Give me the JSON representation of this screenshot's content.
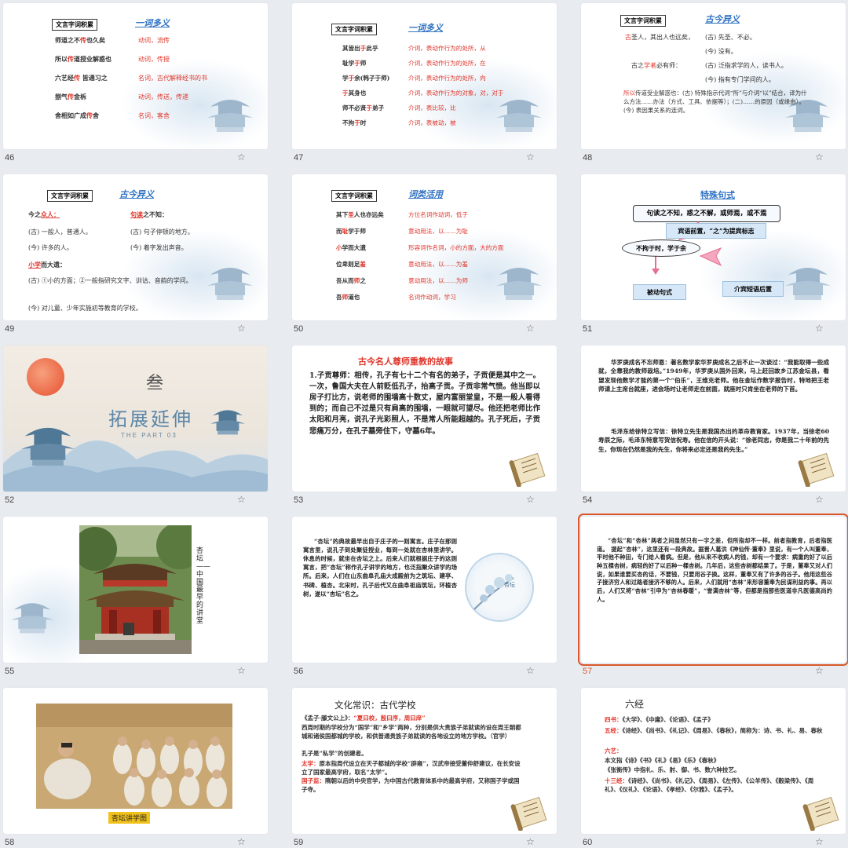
{
  "common": {
    "tag": "文言字词积累",
    "star": "☆"
  },
  "s46": {
    "num": "46",
    "title": "一词多义",
    "rows": [
      {
        "a": "师道之不",
        "r": "传",
        "b": "也久矣",
        "m": "动词，流传"
      },
      {
        "a": "所以",
        "r": "传",
        "b": "道授业解惑也",
        "m": "动词，传授"
      },
      {
        "a": "六艺经",
        "r": "传",
        "b": " 皆通习之",
        "m": "名词，古代解释经书的书"
      },
      {
        "a": "捌气",
        "r": "传",
        "b": "金柝",
        "m": "动词，传送，传递"
      },
      {
        "a": "舍相如广成",
        "r": "传",
        "b": "舍",
        "m": "名词，客舍"
      }
    ]
  },
  "s47": {
    "num": "47",
    "title": "一词多义",
    "rows": [
      {
        "a": "其皆出",
        "r": "于",
        "b": "此乎",
        "m": "介词，表动作行为的处所，从"
      },
      {
        "a": "耻学",
        "r": "于",
        "b": "师",
        "m": "介词，表动作行为的处所，在"
      },
      {
        "a": "学",
        "r": "于",
        "b": "余(韩子于师)",
        "m": "介词，表动作行为的处所，向"
      },
      {
        "a": "",
        "r": "于",
        "b": "其身也",
        "m": "介词，表动作行为的对象，对，对于"
      },
      {
        "a": "师不必贤",
        "r": "于",
        "b": "弟子",
        "m": "介词，表比较，比"
      },
      {
        "a": "不拘",
        "r": "于",
        "b": "时",
        "m": "介词，表被动，被"
      }
    ]
  },
  "s48": {
    "num": "48",
    "title": "古今异义",
    "l1a": "古",
    "l1b": "之",
    "l1c": "圣人，其出人也远矣，",
    "l1d": "(古) 先圣、不必。",
    "l2": "(今) 没有。",
    "l3a": "古之",
    "l3r": "学者",
    "l3b": "必有师：",
    "l3c": "(古) 泛指求学的人，读书人。",
    "l4": "(今) 指有专门学问的人。",
    "l5r": "所以",
    "l5": "传道受业解惑也：(古) 特殊指示代词“所”与介词“以”结合，译为什么方法……办法（方式、工具、依据等）；(二)……的原因（或缘由）。(今) 表因果关系的连词。"
  },
  "s49": {
    "num": "49",
    "title": "古今异义",
    "a1": "今之",
    "a1r": "众人：",
    "b1r": "句读",
    "b1": "之不知：",
    "a2": "(古) 一般人，普通人。",
    "b2": "(古) 句子停顿的地方。",
    "a3": "(今) 许多的人。",
    "b3": "(今) 着字发出声音。",
    "c1r": "小学",
    "c1": "而大遗：",
    "c2": "(古) ①小的方面；②一般指研究文字、训诂、音韵的学问。",
    "c3": "(今) 对儿童、少年实施初等教育的学校。"
  },
  "s50": {
    "num": "50",
    "title": "词类活用",
    "rows": [
      {
        "a": "其下",
        "r": "圣",
        "b": "人也亦远矣",
        "m": "方位名词作动词，低于"
      },
      {
        "a": "而",
        "r": "耻",
        "b": "学于师",
        "m": "意动用法，以……为耻"
      },
      {
        "a": "",
        "r": "小",
        "b": "学而大遗",
        "m": "形容词作名词，小的方面，大的方面"
      },
      {
        "a": "位卑则足",
        "r": "羞",
        "b": "",
        "m": "意动用法，以……为羞"
      },
      {
        "a": "吾从而",
        "r": "师",
        "b": "之",
        "m": "意动用法，以……为师"
      },
      {
        "a": "吾",
        "r": "师",
        "b": "道也",
        "m": "名词作动词，学习"
      }
    ]
  },
  "s51": {
    "num": "51",
    "title": "特殊句式",
    "box1": "句读之不知，惑之不解，或师焉，或不焉",
    "box2": "宾语前置，“之”为提宾标志",
    "box3": "不拘于时，学于余",
    "box4": "被动句式",
    "box5": "介宾短语后置"
  },
  "s52": {
    "num": "52",
    "part": "叁",
    "title": "拓展延伸",
    "sub": "THE PART 03"
  },
  "s53": {
    "num": "53",
    "title": "古今名人尊师重教的故事",
    "text": "1.子贡尊师：相传，孔子有七十二个有名的弟子，子贡便是其中之一。一次，鲁国大夫在人前贬低孔子，抬高子贡。子贡非常气愤。他当即以房子打比方，说老师的围墙高十数丈，屋内富丽堂皇，不是一般人看得到的；而自己不过是只有肩高的围墙，一眼就可望尽。他还把老师比作太阳和月亮，说孔子光彩照人，不是常人所能超越的。孔子死后，子贡悲痛万分，在孔子墓旁住下，守墓6年。"
  },
  "s54": {
    "num": "54",
    "text1": "华罗庚成名不忘师恩：著名数学家华罗庚成名之后不止一次谈过：“我能取得一些成就，全靠我的教师栽培。”1949年，华罗庚从国外回来，马上赶回故乡江苏金坛县，看望发现他数学才能的第一个“伯乐”，王维克老师。他在金坛作数学报告时，特地把王老师请上主席台就座，进会场时让老师走在前面，就座时只肯坐在老师的下首。",
    "text2": "毛泽东给徐特立写信：徐特立先生是我国杰出的革命教育家。1937年，当徐老60寿辰之际，毛泽东特意写贺信祝寿。他在信的开头说：“徐老同志，你是我二十年前的先生，你现在仍然是我的先生，你将来必定还是我的先生。”"
  },
  "s55": {
    "num": "55",
    "caption": "杏坛——中国最早的讲堂"
  },
  "s56": {
    "num": "56",
    "text": "“杏坛”的典故最早出自于庄子的一则寓言。庄子在那则寓言里，说孔子到处聚徒授业，每到一处就在杏林里讲学。休息的时候，就坐在杏坛之上。后来人们就根据庄子的这则寓言，把“杏坛”称作孔子讲学的地方，也泛指聚众讲学的场所。后来，人们在山东曲阜孔庙大成殿前为之筑坛、建亭、书碑、植杏。北宋时，孔子后代又在曲阜祖庙筑坛，环植杏树，遂以“杏坛”名之。",
    "circle": "杏坛"
  },
  "s57": {
    "num": "57",
    "text": "“杏坛”和“杏林”两者之间虽然只有一字之差，但所指却不一样。前者指教育，后者指医道。　提起“杏林”，这里还有一段典故。据晋人葛洪《神仙传·董奉》里说，有一个人叫董奉，平时他不种田，专门给人看病。但是，他从来不收病人的钱，却有一个要求：病重的好了以后种五棵杏树，病轻的好了以后种一棵杏树。几年后，这些杏树都结果了。于是，董奉又对人们说，如果谁要买杏的话，不要钱，只要用谷子换。这样，董奉又有了许多的谷子。他用这些谷子接济穷人和过路者接济不够的人。后来，人们就用“杏林”来形容董奉为民谋利益的事。再以后，人们又将“杏林”引申为“杏林春暖”，“誉满杏林”等，但都是指那些医道非凡医德高尚的人。"
  },
  "s58": {
    "num": "58",
    "caption": "杏坛讲学图"
  },
  "s59": {
    "num": "59",
    "title": "文化常识：古代学校",
    "l1a": "《孟子·滕文公上》：",
    "l1r": "“夏曰校，殷曰序，周曰庠”",
    "l2": "西周时期的学校分为“国学”和“乡学”两种，分别是供大贵族子弟就读的设在周王朝都城和诸侯国都城的学校，和供普通贵族子弟就读的各地设立的地方学校。（官学）",
    "l3": "孔子是“私学”的创建者。",
    "l4r": "太学：",
    "l4": "原本指周代设立在天子都城的学校“辟雍”，汉武帝接受董仲舒建议，在长安设立了国家最高学府，取名“太学”。",
    "l5r": "国子监：",
    "l5": "隋朝以后的中央官学，为中国古代教育体系中的最高学府，又称国子学或国子寺。"
  },
  "s60": {
    "num": "60",
    "title": "六经",
    "l1r": "四书：",
    "l1": "《大学》、《中庸》、《论语》、《孟子》",
    "l2r": "五经：",
    "l2": "《诗经》、《尚书》、《礼记》、《周易》、《春秋》，简称为：诗、书、礼、易、春秋",
    "l3r": "六艺：",
    "l3": "",
    "l4": "本文指《诗》《书》《礼》《易》《乐》《春秋》",
    "l5": "《张衡传》中指礼、乐、射、御、书、数六种技艺。",
    "l6r": "十三经：",
    "l6": "《诗经》、《尚书》、《礼记》、《周易》、《左传》、《公羊传》、《穀梁传》、《周礼》、《仪礼》、《论语》、《孝经》、《尔雅》、《孟子》。"
  }
}
